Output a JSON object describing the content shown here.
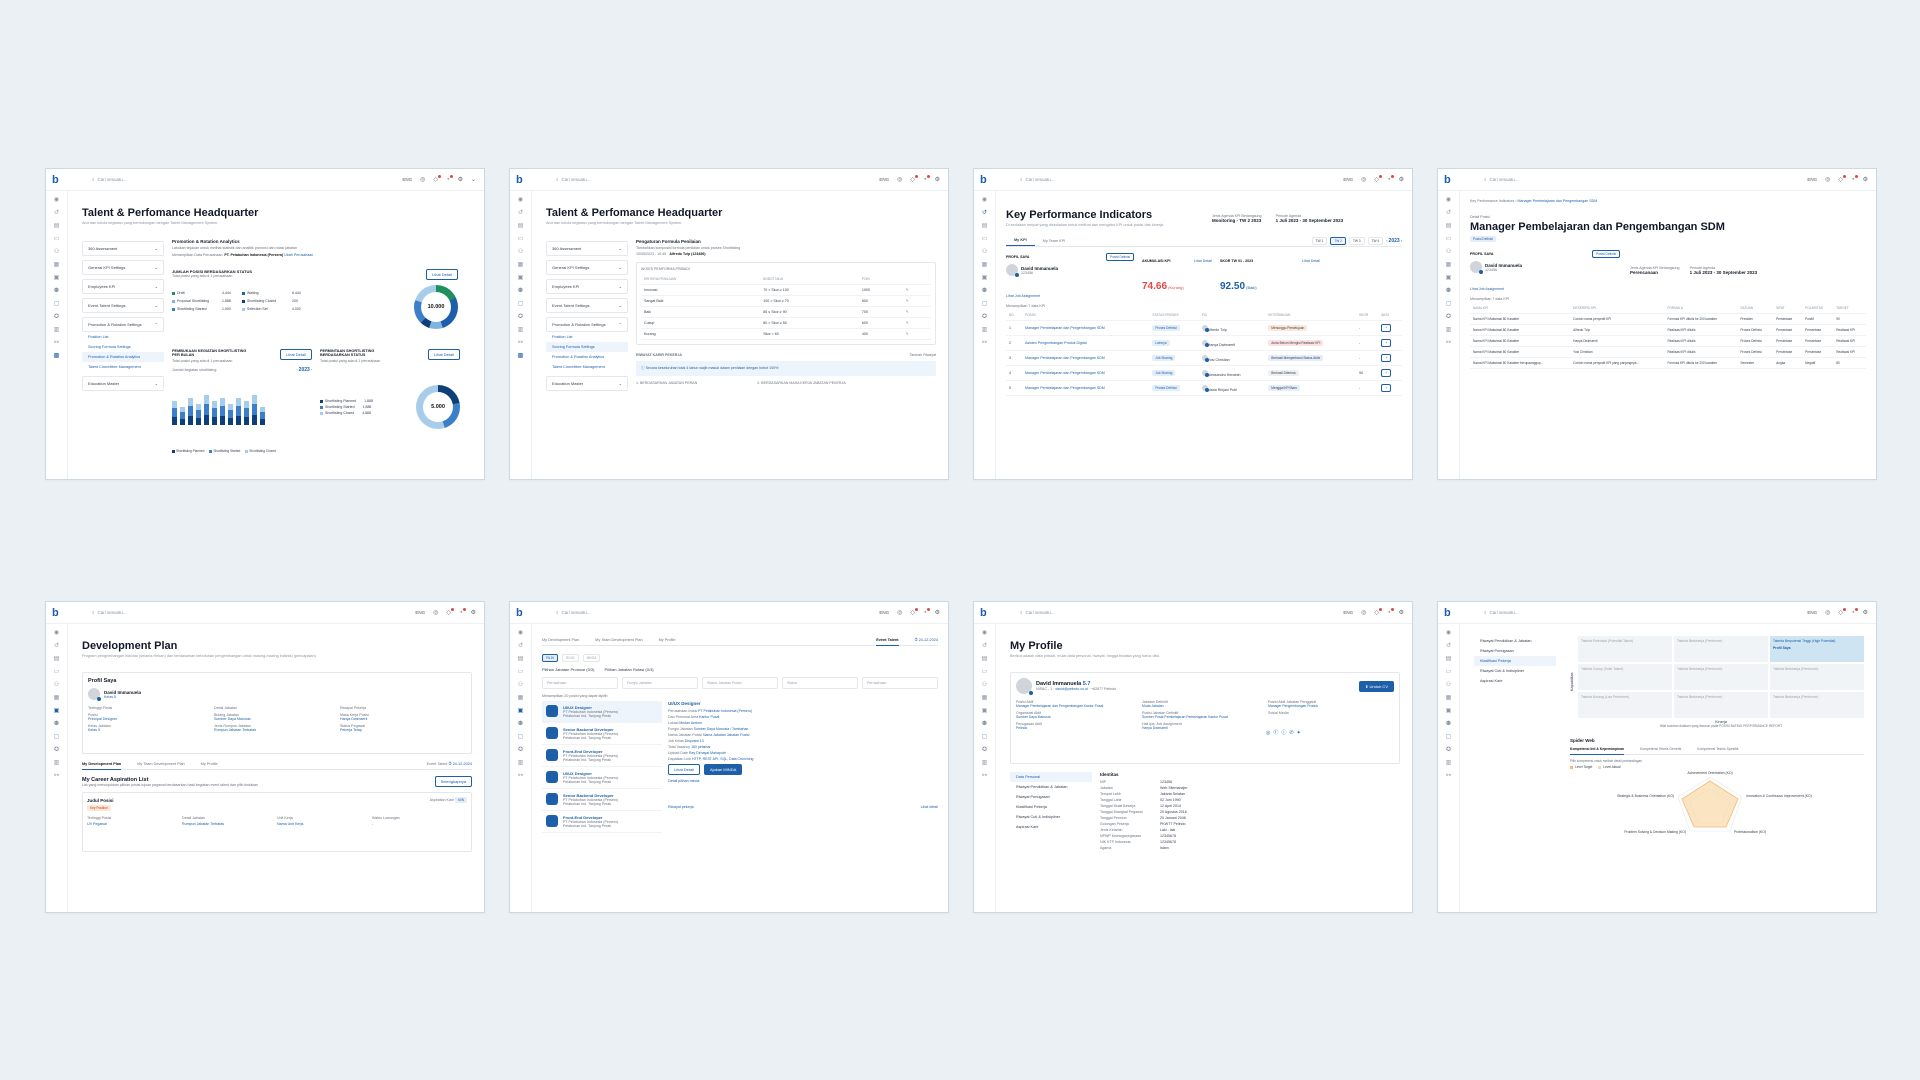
{
  "common": {
    "search_placeholder": "Cari sesuatu...",
    "lang": "ENG"
  },
  "card1": {
    "title": "Talent & Perfomance Headquarter",
    "subtitle": "Atur dan kelola kegiatan yang berhubungan dengan Talent Management System",
    "menu": [
      "360 Assessment",
      "General KPI Settings",
      "Employees KPI",
      "Event Talent Settings",
      "Promotion & Rotation Settings",
      "Education Master"
    ],
    "submenu": [
      "Position List",
      "Scoring Formula Settings",
      "Promotion & Rotation Analytics",
      "Talent Committee Management"
    ],
    "section_title": "Promotion & Rotation Analytics",
    "section_desc": "Lakukan tinjauan untuk melihat statistik dan analitik promosi dan rotasi jabatan",
    "company_label": "Menampilkan Data Perusahaan:",
    "company": "PT. Pelabuhan Indonesia (Persero)",
    "company_link": "Ubah Perusahaan",
    "pos_title": "JUMLAH POSISI BERDASARKAN STATUS",
    "pos_desc": "Total posisi yang ada di 1 perusahaan",
    "detail": "Lihat Detail",
    "pos_total": "10.000",
    "pos_legend": [
      {
        "label": "Draft",
        "value": "4,444",
        "color": "#1e8f5e"
      },
      {
        "label": "Waiting",
        "value": "6,444",
        "color": "#1d5fa8"
      },
      {
        "label": "Proposal Shortlisting",
        "value": "1,888",
        "color": "#7fb3e0"
      },
      {
        "label": "Shortlisting Closed",
        "value": "200",
        "color": "#0e3f78"
      },
      {
        "label": "Shortlisting Started",
        "value": "1,900",
        "color": "#3a7fc7"
      },
      {
        "label": "Selection Set",
        "value": "4,000",
        "color": "#a8cdea"
      }
    ],
    "bar_title": "PEMBUKAAN KEGIATAN SHORTLISTING PER BULAN",
    "bar_desc": "Total posisi yang ada di 1 perusahaan",
    "year": "2023",
    "bar_sub": "Jumlah kegiatan shortlisting",
    "bar_legend": [
      "Shortlisting Planned",
      "Shortlisting Started",
      "Shortlisting Closed"
    ],
    "bar_values": [
      8,
      6,
      9,
      7,
      10,
      8,
      9,
      7,
      9,
      8,
      10,
      6
    ],
    "req_title": "PERMINTAAN SHORTLISTING BERDASARKAN STATUS",
    "req_desc": "Total posisi yang ada di 1 perusahaan",
    "req_total": "5.000",
    "req_legend": [
      {
        "label": "Shortlisting Planned",
        "value": "1,888",
        "color": "#0e3f78"
      },
      {
        "label": "Shortlisting Started",
        "value": "1,888",
        "color": "#3a7fc7"
      },
      {
        "label": "Shortlisting Closed",
        "value": "4,888",
        "color": "#a8cdea"
      }
    ]
  },
  "card2": {
    "title": "Talent & Perfomance Headquarter",
    "subtitle": "Atur dan kelola kegiatan yang berhubungan dengan Talent Management System",
    "section_title": "Pengaturan Formula Penilaian",
    "section_desc": "Tambahkan komposisi formula penilaian untuk proses Shortlisting",
    "meta_date": "10/05/2023 - 10:45",
    "meta_by": "Alfredo Tzip (123456)",
    "table_title": "AKSES PEMFORMA PRIBADI",
    "cols": [
      "KRITERIA PENILAIAN",
      "BOBOT NILAI",
      "POIN"
    ],
    "rows": [
      [
        "Innovasi",
        "70 > Skor ≥ 100",
        "1000"
      ],
      [
        "Sangat Baik",
        "100 > Skor ≥ 70",
        "800"
      ],
      [
        "Baik",
        "85 ≤ Skor ≥ 90",
        "700"
      ],
      [
        "Cukup",
        "80 > Skor ≥ 50",
        "600"
      ],
      [
        "Kurang",
        "Skor < 60",
        "400"
      ]
    ],
    "note_title": "RIWAYAT KARIR PEKERJA",
    "note_btn": "Tambah Riwayat",
    "info": "Secara keseluruhan total 4 tahun wajib masuk dalam penilaian dengan bobot 100%",
    "f1": "1. BERDASARKAN JABATAN PERAN",
    "f2": "2. BERDASARKAN MASA KERJA JABATAN PEKERJA"
  },
  "card3": {
    "title": "Key Performance Indicators",
    "subtitle": "Di sediakan tempat yang disediakan untuk melihat dan mengatur KPI untuk posisi dan kinerja.",
    "agenda_label": "Jenis Agenda KPI Berlangsung",
    "agenda": "Monitoring - TW 2 2023",
    "period_label": "Periode Agenda",
    "period": "1 Juli 2023 - 30 September 2023",
    "tabs": [
      "My KPI",
      "My Team KPI"
    ],
    "tw": [
      "TW 1",
      "TW 2",
      "TW 3",
      "TW 4"
    ],
    "year": "2023",
    "profile_label": "PROFIL SAYA",
    "name": "David Immanuela",
    "nip": "123456",
    "job_link": "Lihat Job Assignment",
    "kpi_label": "AKUMULASI KPI",
    "kpi_value": "74.66",
    "kpi_grade": "(Kurang)",
    "tw_label": "SKOR TW 01 - 2023",
    "tw_value": "92.50",
    "tw_grade": "(Baik)",
    "detail": "Lihat Detail",
    "showing": "Menampilkan 7 data KPI",
    "cols": [
      "NO",
      "POSISI",
      "STATUS PROSES",
      "PIC",
      "KETERANGAN",
      "SKOR",
      "AKSI"
    ],
    "rows": [
      {
        "no": "1",
        "pos": "Manager Pembelajaran dan Pengembangan SDM",
        "status": "Proses Definisi",
        "pic": "Alfredo Tzip",
        "ket": "Menunggu Persetujuan",
        "score": "-",
        "color": "#fde7d7"
      },
      {
        "no": "2",
        "pos": "Asisten Pengembangan Produk Digital",
        "status": "Lainnya",
        "pic": "Hanya Dwimaerti",
        "ket": "Anda Belum Mengisi Realisasi KPI",
        "score": "-",
        "color": "#fde2e2"
      },
      {
        "no": "3",
        "pos": "Manager Pembelajaran dan Pengembangan SDM",
        "status": "Job Sharing",
        "pic": "Yosi Christian",
        "ket": "Berhasil Memperbarui Status Akhir",
        "score": "-",
        "color": "#e4eef9"
      },
      {
        "no": "4",
        "pos": "Manager Pembelajaran dan Pengembangan SDM",
        "status": "Job Sharing",
        "pic": "Alessandro Hendrah",
        "ket": "Berhasil Diterima",
        "score": "90",
        "color": "#eef1f4"
      },
      {
        "no": "5",
        "pos": "Manager Pembelajaran dan Pengembangan SDM",
        "status": "Proses Definisi",
        "pic": "Maria Rinjani Putri",
        "ket": "Menggal KPI Baru",
        "score": "-",
        "color": "#e4eef9"
      }
    ]
  },
  "card4": {
    "breadcrumb1": "Key Performance Indicators",
    "breadcrumb2": "Manager Pembelajaran dan Pengembangan SDM",
    "pre": "Detail Posisi",
    "title": "Manager Pembelajaran dan Pengembangan SDM",
    "badge": "Posisi Definisi",
    "profile_label": "PROFIL SAYA",
    "name": "David Immanuela",
    "nip": "123456",
    "agenda_label": "Jenis Agenda KPI Berlangsung",
    "agenda": "Perencanaan",
    "period_label": "Periode Agenda",
    "period": "1 Juli 2023 - 30 September 2023",
    "job_link": "Lihat Job Assignment",
    "showing": "Menampilkan 7 data KPI",
    "cols": [
      "NAMA KPI",
      "DESKRIPSI KPI",
      "FORMULA",
      "SATUAN",
      "SIFAT",
      "POLARITAS",
      "TARGET"
    ],
    "rows": [
      [
        "Nama KPI Maksimal 80 Karakter",
        "Contoh nama penyedit KPI",
        "Formula KPI ditulis ke 200 karakter",
        "Presiden",
        "Persentase",
        "Positif",
        "90"
      ],
      [
        "Nama KPI Maksimal 80 Karakter",
        "Alfredo Tzip",
        "Realisasi KPI ditulis",
        "Proses Definisi",
        "Persentase",
        "Persentase",
        "Realisasi KPI"
      ],
      [
        "Nama KPI Maksimal 80 Karakter",
        "Hanya Dwimaerti",
        "Realisasi KPI ditulis",
        "Proses Definisi",
        "Persentase",
        "Persentase",
        "Realisasi KPI"
      ],
      [
        "Nama KPI Maksimal 80 Karakter",
        "Yosi Christian",
        "Realisasi KPI ditulis",
        "Proses Definisi",
        "Persentase",
        "Persentase",
        "Realisasi KPI"
      ],
      [
        "Nama KPI Maksimal 80 Karakter berupaanggup...",
        "Contoh nama penyedit KPI yang panjangnya...",
        "Formula KPI ditulis ke 200 karakter",
        "Semester",
        "Angka",
        "Negatif",
        "80"
      ]
    ]
  },
  "card5": {
    "title": "Development Plan",
    "subtitle": "Program pengembangan individu (selama Rekan) dan berdasarkan kebutuhan pengembangan untuk masing-masing individu (pencapaian)",
    "profile_title": "Profil Saya",
    "name": "David Immanuela",
    "kelas": "Kelas 5",
    "f": [
      {
        "label": "Tertinggi Posisi",
        "value": ""
      },
      {
        "label": "Detail Jabatan",
        "value": ""
      },
      {
        "label": "Riwayat Pekerja",
        "value": ""
      },
      {
        "label": "Posisi",
        "value": "Principal Designer"
      },
      {
        "label": "Bidang Jabatan",
        "value": "Sumber Daya Manusia"
      },
      {
        "label": "Masa Kerja Posisi",
        "value": "Hanya Dwimaerti"
      },
      {
        "label": "Kelas Jabatan",
        "value": "Kelas 5"
      },
      {
        "label": "Jenis Rumpun Jabatan",
        "value": "Rumpun Jabatan Terbatas"
      },
      {
        "label": "Status Pegawai",
        "value": "Pekerja Tetap"
      }
    ],
    "tabs": [
      "My Development Plan",
      "My Team Development Plan",
      "My Profile"
    ],
    "event": "Event Talent",
    "event_date": "24-12-2024",
    "aspiration": "My Career Aspiration List",
    "aspiration_desc": "List yang menunjukkan pilihan posisi tujuan pegawai berdasarkan hasil kegiatan event talent dan pilih tindakan",
    "aspiration_btn": "Selengkapnya",
    "asp_pos": "Judul Posisi",
    "asp_tag": "Aspiration Karir",
    "asp_cols": [
      "Tertinggi Posisi",
      "Detail Jabatan",
      "Unit Kerja",
      "Waktu Lowongan"
    ],
    "asp_vals": [
      "UX Pegawai",
      "Rumpun Jabatan Terbatas",
      "Nama Unit Kerja",
      "-"
    ]
  },
  "card6": {
    "tabs": [
      "My Development Plan",
      "My Team Development Plan",
      "My Profile",
      "Event Talent"
    ],
    "event_date": "24-12-2024",
    "chips": [
      "PILIH",
      "ROLE",
      "MINTA"
    ],
    "promo": "Pilihan Jabatan Promosi (0/3)",
    "rotate": "Pilihan Jabatan Rotasi (0/3)",
    "filters": [
      "Perusahaan",
      "Fungsi Jabatan",
      "Status Jabatan Posisi",
      "Status",
      "Perusahaan"
    ],
    "showing": "Menampilkan 20 posisi yang dapat dipilih",
    "jobs": [
      {
        "title": "UI/UX Designer",
        "co": "PT Pelabuhan Indonesia (Persero)",
        "loc": "Pelabuhan Ind. Tanjung Perak"
      },
      {
        "title": "Senior Backend Developer",
        "co": "PT Pelabuhan Indonesia (Persero)",
        "loc": "Pelabuhan Ind. Tanjung Perak"
      },
      {
        "title": "Front-End Developer",
        "co": "PT Pelabuhan Indonesia (Persero)",
        "loc": "Pelabuhan Ind. Tanjung Perak"
      },
      {
        "title": "UI/UX Designer",
        "co": "PT Pelabuhan Indonesia (Persero)",
        "loc": "Pelabuhan Ind. Tanjung Perak"
      },
      {
        "title": "Senior Backend Developer",
        "co": "PT Pelabuhan Indonesia (Persero)",
        "loc": "Pelabuhan Ind. Tanjung Perak"
      },
      {
        "title": "Front-End Developer",
        "co": "PT Pelabuhan Indonesia (Persero)",
        "loc": "Pelabuhan Ind. Tanjung Perak"
      }
    ],
    "detail_title": "UI/UX Designer",
    "detail_rows": [
      {
        "k": "Perusahaan Induk",
        "v": "PT Pelabuhan Indonesia (Persero)"
      },
      {
        "k": "Dari Personal Area",
        "v": "Kantor Pusat"
      },
      {
        "k": "Lokasi",
        "v": "Medan Ambon"
      },
      {
        "k": "Fungsi Jabatan",
        "v": "Sumber Daya Manusia / Tambahan"
      },
      {
        "k": "Nama Jabatan Posisi",
        "v": "Nama Jabatan Jabatan Posisi"
      },
      {
        "k": "Job Kelas",
        "v": "Disposisi 13"
      },
      {
        "k": "Total Vacancy",
        "v": "150 pelamar"
      },
      {
        "k": "Upload Date",
        "v": "Ray Dirhayat Mahaputri"
      },
      {
        "k": "Dapatkan Link",
        "v": "HTTP, REST API, SQL, Data Crunching"
      }
    ],
    "btn1": "Lihat Detail",
    "btn2": "Ajukan MINDA",
    "pilih": "Detail pilihan minda",
    "history": "Riwayat pekerja",
    "more": "Lihat detail"
  },
  "card7": {
    "title": "My Profile",
    "subtitle": "Berikut adalah data pribadi, mulai data personal, riwayat, hingga biodata yang harus diisi.",
    "name": "David Immanuela",
    "rating": "5.7",
    "nip": "NIS&C - 1",
    "email": "david@pelindo.co.id",
    "phone": "+62877 Pelindo",
    "cv_btn": "Unduh CV",
    "info": [
      {
        "k": "Posisi Aktif",
        "v": "Manager Pembelajaran dan Pengembangan Kantor Pusat"
      },
      {
        "k": "Jabatan Definitif",
        "v": "Muda Jabatan"
      },
      {
        "k": "Posisi Aktif Jabatan Pengganti",
        "v": "Manager Pengembangan Produk"
      },
      {
        "k": "Organisasi Aktif",
        "v": "Sumber Daya Manusia"
      },
      {
        "k": "Posisi Jabatan Definitif",
        "v": "Sumber Pusat Pembelajaran Pembelajaran Kantor Pusat"
      },
      {
        "k": "Sosial Media",
        "v": ""
      },
      {
        "k": "Penugasan Aktif",
        "v": "Pelindo"
      },
      {
        "k": "Hak Ipa, Job Assignment",
        "v": "Hanya Dwimaerti"
      }
    ],
    "menu": [
      "Data Personal",
      "Riwayat Pendidikan & Jabatan",
      "Riwayat Penugasan",
      "Klasifikasi Pekerja",
      "Riwayat Cuti & Indisipliner",
      "Aspirasi Karir"
    ],
    "ident_title": "Identitas",
    "ident": [
      {
        "k": "NIP",
        "v": "123456"
      },
      {
        "k": "Jabatan",
        "v": "Web Sitemanajer"
      },
      {
        "k": "Tempat Lahir",
        "v": "Jakarta Selatan"
      },
      {
        "k": "Tanggal Lahir",
        "v": "02 Juni 1990"
      },
      {
        "k": "Tanggal Mulai Bekerja",
        "v": "12 April 2014"
      },
      {
        "k": "Tanggal Diangkat Pegawai",
        "v": "20 Agustus 2016"
      },
      {
        "k": "Tanggal Pensiun",
        "v": "20 Januari 2046"
      },
      {
        "k": "Golongan Pekerja",
        "v": "PKWTT Pelindo"
      },
      {
        "k": "Jenis Kelamin",
        "v": "Laki - laki"
      },
      {
        "k": "NPWP Kewarganegaraan",
        "v": "12345678"
      },
      {
        "k": "NIK KTP Indonesia",
        "v": "12345678"
      },
      {
        "k": "Agama",
        "v": "Islam"
      }
    ]
  },
  "card8": {
    "menu": [
      "Riwayat Pendidikan & Jabatan",
      "Riwayat Penugasan",
      "Klasifikasi Pekerja",
      "Riwayat Cuti & Indisipliner",
      "Aspirasi Karir"
    ],
    "axis_y": "Kapabilitas",
    "axis_x": "Kinerja",
    "cells": [
      "Talenta Potensial (Potential Talent)",
      "Talenta Berkinerja (Performer)",
      "Talenta Berpotensi Tinggi (High Potential)",
      "Talenta Cukup (Solid Talent)",
      "Talenta Berkinerja (Performer)",
      "Talenta Berkinerja (Performer)",
      "Talenta Kurang (Low Performer)",
      "Talenta Berkinerja (Performer)",
      "Talenta Berkinerja (Performer)"
    ],
    "profile_tag": "Profil Saya",
    "box_note": "Nilai kuadran didalam yang disusun pada POSISI BATING PERFORMANCE REPORT",
    "spider_title": "Spider Web",
    "spider_tabs": [
      "Kompetensi Inti & Kepemimpinan",
      "Kompetensi Teknis Generik",
      "Kompetensi Teknis Spesifik"
    ],
    "spider_note": "Pilih kompetensi untuk melihat detail perbandingan",
    "spider_legend": [
      "Level Target",
      "Level Aktual"
    ],
    "spider_labels": [
      "Achievement Orientation (KO)",
      "Innovation & Continuous Improvement (KO)",
      "Professionalism (KO)",
      "Problem Solving & Decision Making (KO)",
      "Strategic & Business Orientation (KO)"
    ]
  }
}
